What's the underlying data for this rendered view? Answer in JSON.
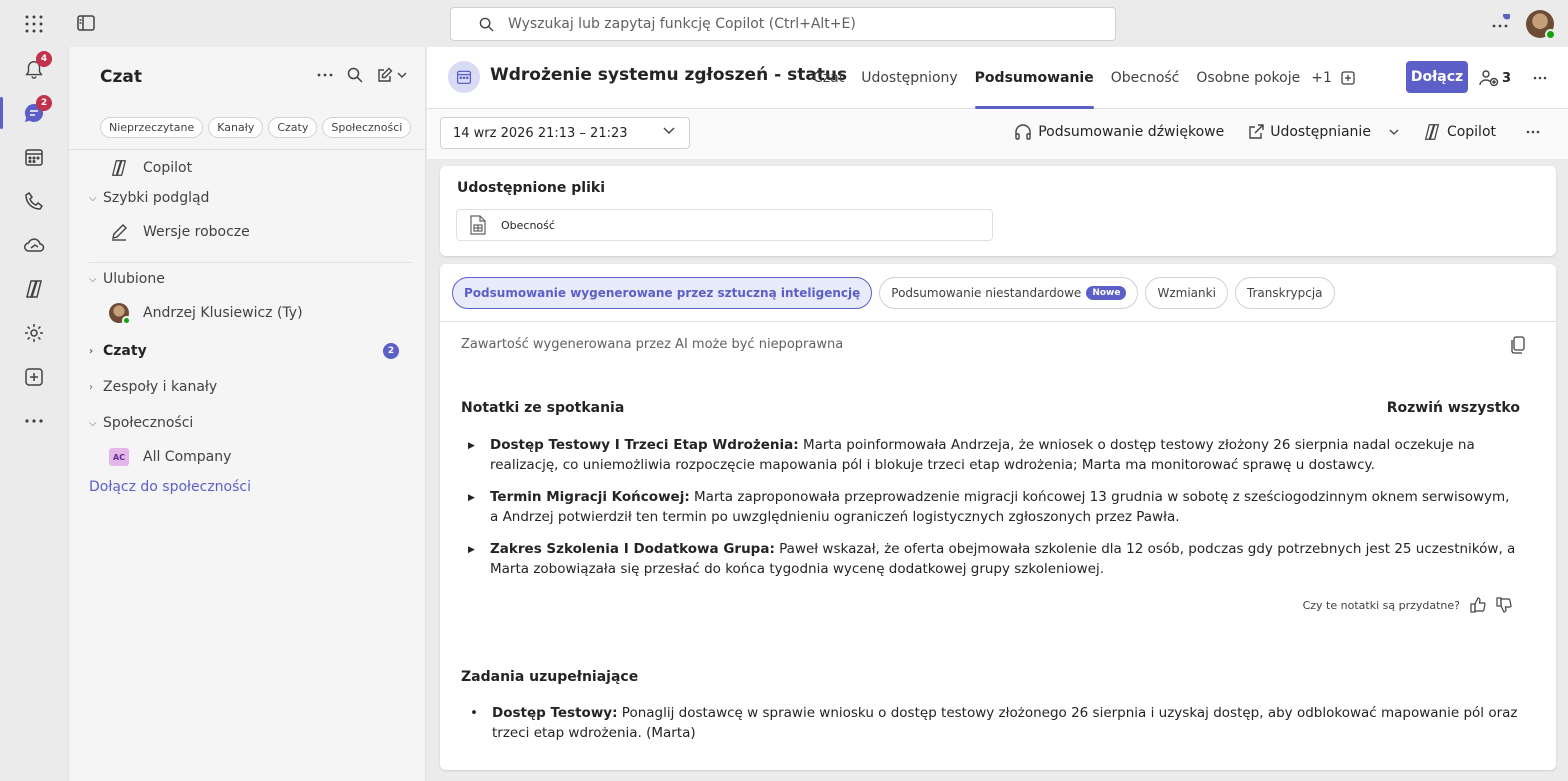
{
  "search": {
    "placeholder": "Wyszukaj lub zapytaj funkcję Copilot (Ctrl+Alt+E)"
  },
  "rail": {
    "activity_badge": "4",
    "chat_badge": "2"
  },
  "sidebar": {
    "title": "Czat",
    "filters": [
      "Nieprzeczytane",
      "Kanały",
      "Czaty",
      "Społeczności"
    ],
    "copilot": "Copilot",
    "quick_view": "Szybki podgląd",
    "drafts": "Wersje robocze",
    "favorites": "Ulubione",
    "me": "Andrzej Klusiewicz (Ty)",
    "chats": "Czaty",
    "chats_count": "2",
    "teams": "Zespoły i kanały",
    "communities": "Społeczności",
    "all_company_tile": "AC",
    "all_company": "All Company",
    "join_community": "Dołącz do społeczności"
  },
  "header": {
    "title": "Wdrożenie systemu zgłoszeń - status",
    "tabs": [
      "Czat",
      "Udostępniony",
      "Podsumowanie",
      "Obecność",
      "Osobne pokoje",
      "+1"
    ],
    "join": "Dołącz",
    "participants": "3"
  },
  "toolbar": {
    "date": "14 wrz 2026 21:13 – 21:23",
    "audio": "Podsumowanie dźwiękowe",
    "share": "Udostępnianie",
    "copilot": "Copilot"
  },
  "files": {
    "title": "Udostępnione pliki",
    "file": "Obecność"
  },
  "summary": {
    "tabs": [
      "Podsumowanie wygenerowane przez sztuczną inteligencję",
      "Podsumowanie niestandardowe",
      "Wzmianki",
      "Transkrypcja"
    ],
    "new_badge": "Nowe",
    "disclaimer": "Zawartość wygenerowana przez AI może być niepoprawna",
    "notes_title": "Notatki ze spotkania",
    "expand_all": "Rozwiń wszystko",
    "notes": [
      {
        "title": "Dostęp Testowy I Trzeci Etap Wdrożenia:",
        "text": " Marta poinformowała Andrzeja, że wniosek o dostęp testowy złożony 26 sierpnia nadal oczekuje na realizację, co uniemożliwia rozpoczęcie mapowania pól i blokuje trzeci etap wdrożenia; Marta ma monitorować sprawę u dostawcy."
      },
      {
        "title": "Termin Migracji Końcowej:",
        "text": " Marta zaproponowała przeprowadzenie migracji końcowej 13 grudnia w sobotę z sześciogodzinnym oknem serwisowym, a Andrzej potwierdził ten termin po uwzględnieniu ograniczeń logistycznych zgłoszonych przez Pawła."
      },
      {
        "title": "Zakres Szkolenia I Dodatkowa Grupa:",
        "text": " Paweł wskazał, że oferta obejmowała szkolenie dla 12 osób, podczas gdy potrzebnych jest 25 uczestników, a Marta zobowiązała się przesłać do końca tygodnia wycenę dodatkowej grupy szkoleniowej."
      }
    ],
    "feedback": "Czy te notatki są przydatne?",
    "tasks_title": "Zadania uzupełniające",
    "tasks": [
      {
        "title": "Dostęp Testowy:",
        "text": " Ponaglij dostawcę w sprawie wniosku o dostęp testowy złożonego 26 sierpnia i uzyskaj dostęp, aby odblokować mapowanie pól oraz trzeci etap wdrożenia. (Marta)"
      }
    ]
  }
}
